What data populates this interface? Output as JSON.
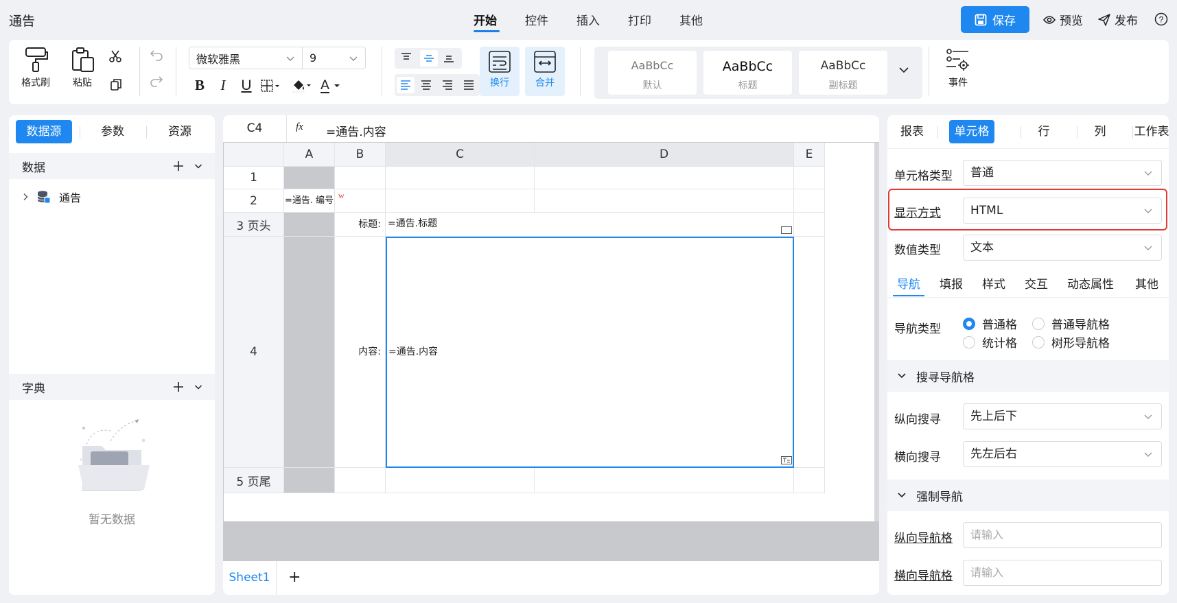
{
  "header": {
    "title": "通告",
    "menu": [
      "开始",
      "控件",
      "插入",
      "打印",
      "其他"
    ],
    "save_label": "保存",
    "preview_label": "预览",
    "publish_label": "发布",
    "help_icon": "question-circle-icon"
  },
  "ribbon": {
    "format_painter": "格式刷",
    "paste": "粘贴",
    "font_family": "微软雅黑",
    "font_size": "9",
    "bold": "B",
    "italic": "I",
    "underline": "U",
    "font_color": "A",
    "wrap": "换行",
    "merge": "合并",
    "styles": [
      {
        "sample": "AaBbCc",
        "name": "默认"
      },
      {
        "sample": "AaBbCc",
        "name": "标题"
      },
      {
        "sample": "AaBbCc",
        "name": "副标题"
      }
    ],
    "event": "事件",
    "accent": "#1e88f0"
  },
  "left_panel": {
    "tabs": [
      "数据源",
      "参数",
      "资源"
    ],
    "data_section": "数据",
    "tree_item": "通告",
    "dict_section": "字典",
    "empty_text": "暂无数据"
  },
  "sheet": {
    "cell_ref": "C4",
    "fx": "fx",
    "formula": "=通告.内容",
    "columns": [
      "A",
      "B",
      "C",
      "D",
      "E"
    ],
    "rows": [
      "1",
      "2",
      "3 页头",
      "4",
      "5 页尾"
    ],
    "a2": "=通告. 编号",
    "b2_marker": "w",
    "b3": "标题:",
    "c3": "=通告.标题",
    "b4": "内容:",
    "c4": "=通告.内容",
    "sheet_tab": "Sheet1",
    "add_sheet": "+"
  },
  "right_panel": {
    "tabs": [
      "报表",
      "单元格",
      "行",
      "列",
      "工作表"
    ],
    "cell_type_label": "单元格类型",
    "cell_type_value": "普通",
    "display_label": "显示方式",
    "display_value": "HTML",
    "value_type_label": "数值类型",
    "value_type_value": "文本",
    "sub_tabs": [
      "导航",
      "填报",
      "样式",
      "交互",
      "动态属性",
      "其他"
    ],
    "nav_type_label": "导航类型",
    "nav_options": [
      "普通格",
      "普通导航格",
      "统计格",
      "树形导航格"
    ],
    "nav_selected": "普通格",
    "search_nav_section": "搜寻导航格",
    "vertical_search_label": "纵向搜寻",
    "vertical_search_value": "先上后下",
    "horizontal_search_label": "横向搜寻",
    "horizontal_search_value": "先左后右",
    "force_nav_section": "强制导航",
    "vertical_nav_label": "纵向导航格",
    "vertical_nav_placeholder": "请输入",
    "horizontal_nav_label": "横向导航格",
    "horizontal_nav_placeholder": "请输入",
    "highlight_color": "#e53935"
  }
}
